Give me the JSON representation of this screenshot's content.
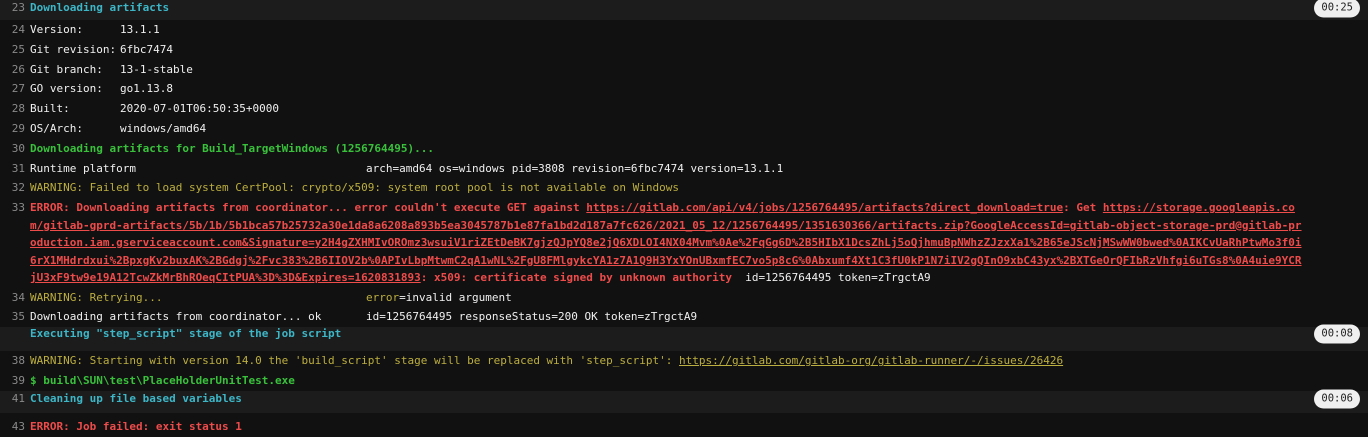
{
  "lines": {
    "l23": {
      "num": "23",
      "text": "Downloading artifacts",
      "badge": "00:25"
    },
    "l24": {
      "num": "24",
      "key": "Version:",
      "val": "13.1.1"
    },
    "l25": {
      "num": "25",
      "key": "Git revision:",
      "val": "6fbc7474"
    },
    "l26": {
      "num": "26",
      "key": "Git branch:",
      "val": "13-1-stable"
    },
    "l27": {
      "num": "27",
      "key": "GO version:",
      "val": "go1.13.8"
    },
    "l28": {
      "num": "28",
      "key": "Built:",
      "val": "2020-07-01T06:50:35+0000"
    },
    "l29": {
      "num": "29",
      "key": "OS/Arch:",
      "val": "windows/amd64"
    },
    "l30": {
      "num": "30",
      "text": "Downloading artifacts for Build_TargetWindows (1256764495)..."
    },
    "l31": {
      "num": "31",
      "left": "Runtime platform",
      "right": "arch=amd64 os=windows pid=3808 revision=6fbc7474 version=13.1.1"
    },
    "l32": {
      "num": "32",
      "text": "WARNING: Failed to load system CertPool: crypto/x509: system root pool is not available on Windows"
    },
    "l33": {
      "num": "33",
      "part1": "ERROR: Downloading artifacts from coordinator... error couldn't execute GET against ",
      "link1": "https://gitlab.com/api/v4/jobs/1256764495/artifacts?direct_download=true",
      "part2": ": Get ",
      "link2": "https://storage.googleapis.com/gitlab-gprd-artifacts/5b/1b/5b1bca57b25732a30e1da8a6208a893b5ea3045787b1e87fa1bd2d187a7fc626/2021_05_12/1256764495/1351630366/artifacts.zip?GoogleAccessId=gitlab-object-storage-prd@gitlab-production.iam.gserviceaccount.com&Signature=y2H4gZXHMIvOROmz3wsuiV1riZEtDeBK7gjzQJpYQ8e2jQ6XDLOI4NX04Mvm%0Ae%2FqGg6D%2B5HIbX1DcsZhLj5oQjhmuBpNWhzZJzxXa1%2B65eJScNjMSwWW0bwed%0AIKCvUaRhPtwMo3f0i6rX1MHdrdxui%2BpxgKv2buxAK%2BGdgj%2Fvc383%2B6IIOV2b%0APIvLbpMtwmC2qA1wNL%2FgU8FMlgykcYA1z7A1Q9H3YxYOnUBxmfEC7vo5p8cG%0Abxumf4Xt1C3fU0kP1N7iIV2gQInO9xbC43yx%2BXTGeOrQFIbRzVhfgi6uTGs8%0A4uie9YCRjU3xF9tw9e19A12TcwZkMrBhROeqCItPUA%3D%3D&Expires=1620831893",
      "part3": ": x509: certificate signed by unknown authority",
      "tail_id": "id=1256764495",
      "tail_token": "token=zTrgctA9"
    },
    "l34": {
      "num": "34",
      "left": "WARNING: Retrying...",
      "err_key": "error",
      "err_val": "=invalid argument"
    },
    "l35": {
      "num": "35",
      "left": "Downloading artifacts from coordinator... ok",
      "right": "id=1256764495 responseStatus=200 OK token=zTrgctA9"
    },
    "l37": {
      "num": "37",
      "text": "Executing \"step_script\" stage of the job script",
      "badge": "00:08"
    },
    "l38": {
      "num": "38",
      "text": "WARNING: Starting with version 14.0 the 'build_script' stage will be replaced with 'step_script': ",
      "link": "https://gitlab.com/gitlab-org/gitlab-runner/-/issues/26426"
    },
    "l39": {
      "num": "39",
      "text": "$ build\\SUN\\test\\PlaceHolderUnitTest.exe"
    },
    "l41": {
      "num": "41",
      "text": "Cleaning up file based variables",
      "badge": "00:06"
    },
    "l43": {
      "num": "43",
      "text": "ERROR: Job failed: exit status 1"
    }
  },
  "colors": {
    "background": "#111111",
    "section_header": "#3db6c7",
    "success": "#39c13c",
    "warning": "#bcae3f",
    "error": "#ee4b4b"
  }
}
